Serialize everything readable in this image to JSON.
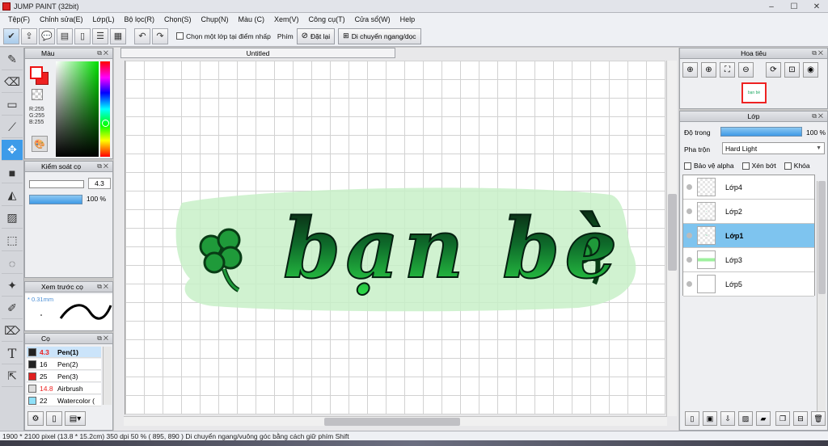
{
  "app": {
    "title": "JUMP PAINT (32bit)",
    "window_controls": [
      "–",
      "☐",
      "✕"
    ]
  },
  "menu": [
    "Tệp(F)",
    "Chỉnh sửa(E)",
    "Lớp(L)",
    "Bộ lọc(R)",
    "Chọn(S)",
    "Chụp(N)",
    "Màu (C)",
    "Xem(V)",
    "Công cụ(T)",
    "Cửa sổ(W)",
    "Help"
  ],
  "toolbar": {
    "layer_select_checkbox": "Chọn một lớp tại điểm nhấp",
    "keys_label": "Phím",
    "reset_button": "Đặt lại",
    "move_button": "Di chuyển ngang/dọc"
  },
  "color_panel": {
    "title": "Màu",
    "rgb": [
      "R:255",
      "G:255",
      "B:255"
    ],
    "fg_color": "#ffffff",
    "bg_color": "#e02020"
  },
  "brush_control": {
    "title": "Kiểm soát cọ",
    "size": "4.3",
    "opacity": "100 %",
    "opacity_fraction": 1.0
  },
  "brush_preview": {
    "title": "Xem trước cọ",
    "size_label": "* 0.31mm"
  },
  "brush_list": {
    "title": "Cọ",
    "items": [
      {
        "size": "4.3",
        "name": "Pen(1)",
        "color": "#222222",
        "selected": true
      },
      {
        "size": "16",
        "name": "Pen(2)",
        "color": "#222222",
        "selected": false
      },
      {
        "size": "25",
        "name": "Pen(3)",
        "color": "#e02020",
        "selected": false
      },
      {
        "size": "14.8",
        "name": "Airbrush",
        "color": "#dddddd",
        "selected": false
      },
      {
        "size": "22",
        "name": "Watercolor (",
        "color": "#8fe0f8",
        "selected": false
      }
    ]
  },
  "canvas": {
    "tab": "Untitled",
    "artwork_text": "bạn bè",
    "watermark_color": "#c8f0c8"
  },
  "navigator": {
    "title": "Hoa tiêu",
    "thumb_text": "bạn bè"
  },
  "layer_panel": {
    "title": "Lớp",
    "opacity_label": "Độ trong",
    "opacity_value": "100 %",
    "opacity_fraction": 1.0,
    "blend_label": "Pha trộn",
    "blend_value": "Hard Light",
    "protect_alpha": "Bảo vệ alpha",
    "clip": "Xén bớt",
    "lock": "Khóa",
    "layers": [
      {
        "name": "Lớp4",
        "selected": false
      },
      {
        "name": "Lớp2",
        "selected": false
      },
      {
        "name": "Lớp1",
        "selected": true
      },
      {
        "name": "Lớp3",
        "selected": false
      },
      {
        "name": "Lớp5",
        "selected": false
      }
    ]
  },
  "status": {
    "text": "1900 * 2100 pixel   (13.8 * 15.2cm)   350 dpi   50 %   ( 895, 890 )   Di chuyển ngang/vuông góc bằng cách giữ phím Shift"
  }
}
